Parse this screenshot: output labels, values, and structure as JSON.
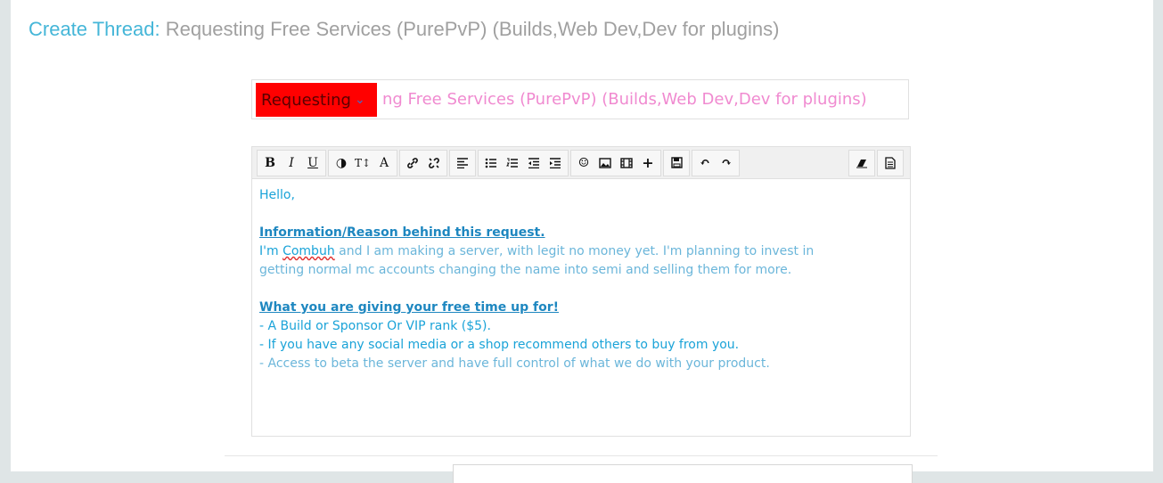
{
  "heading": {
    "lead": "Create Thread:",
    "rest": "Requesting Free Services (PurePvP) (Builds,Web Dev,Dev for plugins)"
  },
  "title_row": {
    "prefix_value": "Requesting",
    "title_value": "ng Free Services (PurePvP) (Builds,Web Dev,Dev for plugins)"
  },
  "toolbar": {
    "bold": "B",
    "italic": "I",
    "underline": "U",
    "color": "◑",
    "size": "T↕",
    "font": "A",
    "link": "🔗",
    "unlink": "⛓",
    "align": "≡",
    "bullet_list": "☰",
    "number_list": "☷",
    "outdent": "⇤",
    "indent": "⇥",
    "smilie": "☺",
    "image": "▣",
    "media": "▦",
    "insert": "+",
    "save": "💾",
    "undo": "↶",
    "redo": "↷",
    "remove_format": "✎",
    "source": "▤"
  },
  "body": {
    "greeting": "Hello,",
    "section1_title": "Information/Reason behind this request.",
    "s1_line1_a": "I'm ",
    "s1_line1_name": "Combuh",
    "s1_line1_b": " and I am making a server, with legit no money yet. I'm planning to invest in",
    "s1_line2": "getting normal mc accounts changing the name into semi and selling them for more.",
    "section2_title": "What you are giving your free time up for!",
    "bullet1": "- A Build or Sponsor Or VIP rank ($5).",
    "bullet2": "- If you have any social media or a shop recommend others to buy from you.",
    "bullet3": "- Access to beta the server and have full control of what we do with your product."
  },
  "colors": {
    "heading_accent": "#45b6d8",
    "prefix_background": "#ff0000",
    "title_text": "#f08ad0",
    "body_text": "#1aa3d8"
  }
}
